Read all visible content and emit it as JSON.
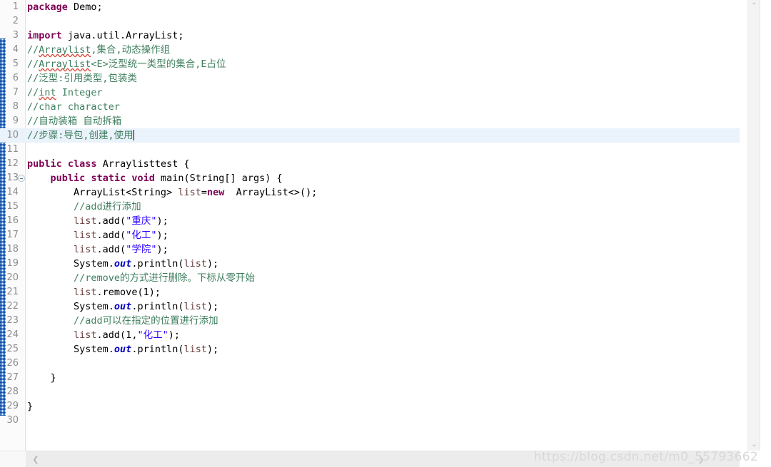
{
  "editor": {
    "gutter_first_line": 1,
    "current_line": 10,
    "total_lines": 30,
    "fold_marker_line": 13,
    "colors": {
      "keyword": "#7F0055",
      "string": "#2A00FF",
      "comment": "#3F7F5F",
      "static_field": "#0000C0",
      "local_variable": "#6A3E3E",
      "current_line_highlight": "#EAF2FB",
      "change_bar": "#1F6FC4",
      "spell_error_underline": "#D84B3C",
      "line_number": "#8D8D8D",
      "background": "#FFFFFF"
    },
    "lines": [
      {
        "n": "1",
        "tokens": [
          {
            "t": "package",
            "c": "kw"
          },
          {
            "t": " Demo;",
            "c": "plain"
          }
        ]
      },
      {
        "n": "2",
        "tokens": []
      },
      {
        "n": "3",
        "tokens": [
          {
            "t": "import",
            "c": "kw"
          },
          {
            "t": " java.util.ArrayList;",
            "c": "plain"
          }
        ]
      },
      {
        "n": "4",
        "tokens": [
          {
            "t": "//",
            "c": "cmt"
          },
          {
            "t": "Arraylist",
            "c": "cmt sq"
          },
          {
            "t": ",集合,动态操作组",
            "c": "cmt"
          }
        ]
      },
      {
        "n": "5",
        "tokens": [
          {
            "t": "//",
            "c": "cmt"
          },
          {
            "t": "Arraylist",
            "c": "cmt sq"
          },
          {
            "t": "<E>泛型统一类型的集合,E占位",
            "c": "cmt"
          }
        ]
      },
      {
        "n": "6",
        "tokens": [
          {
            "t": "//泛型:引用类型,包装类",
            "c": "cmt"
          }
        ]
      },
      {
        "n": "7",
        "tokens": [
          {
            "t": "//",
            "c": "cmt"
          },
          {
            "t": "int",
            "c": "cmt sq"
          },
          {
            "t": " Integer",
            "c": "cmt"
          }
        ]
      },
      {
        "n": "8",
        "tokens": [
          {
            "t": "//char character",
            "c": "cmt"
          }
        ]
      },
      {
        "n": "9",
        "tokens": [
          {
            "t": "//自动装箱 自动拆箱",
            "c": "cmt"
          }
        ]
      },
      {
        "n": "10",
        "tokens": [
          {
            "t": "//步骤:导包,创建,使用",
            "c": "cmt"
          }
        ],
        "caret": true,
        "current": true
      },
      {
        "n": "11",
        "tokens": []
      },
      {
        "n": "12",
        "tokens": [
          {
            "t": "public",
            "c": "kw"
          },
          {
            "t": " ",
            "c": "plain"
          },
          {
            "t": "class",
            "c": "kw"
          },
          {
            "t": " Arraylisttest {",
            "c": "plain"
          }
        ]
      },
      {
        "n": "13",
        "tokens": [
          {
            "t": "    ",
            "c": "plain"
          },
          {
            "t": "public",
            "c": "kw"
          },
          {
            "t": " ",
            "c": "plain"
          },
          {
            "t": "static",
            "c": "kw"
          },
          {
            "t": " ",
            "c": "plain"
          },
          {
            "t": "void",
            "c": "kw"
          },
          {
            "t": " main(String[] args) {",
            "c": "plain"
          }
        ],
        "fold": true
      },
      {
        "n": "14",
        "tokens": [
          {
            "t": "        ArrayList<String> ",
            "c": "plain"
          },
          {
            "t": "list",
            "c": "var"
          },
          {
            "t": "=",
            "c": "plain"
          },
          {
            "t": "new",
            "c": "kw"
          },
          {
            "t": "  ArrayList<>();",
            "c": "plain"
          }
        ]
      },
      {
        "n": "15",
        "tokens": [
          {
            "t": "        //add进行添加",
            "c": "cmt"
          }
        ]
      },
      {
        "n": "16",
        "tokens": [
          {
            "t": "        ",
            "c": "plain"
          },
          {
            "t": "list",
            "c": "var"
          },
          {
            "t": ".add(",
            "c": "plain"
          },
          {
            "t": "\"重庆\"",
            "c": "str"
          },
          {
            "t": ");",
            "c": "plain"
          }
        ]
      },
      {
        "n": "17",
        "tokens": [
          {
            "t": "        ",
            "c": "plain"
          },
          {
            "t": "list",
            "c": "var"
          },
          {
            "t": ".add(",
            "c": "plain"
          },
          {
            "t": "\"化工\"",
            "c": "str"
          },
          {
            "t": ");",
            "c": "plain"
          }
        ]
      },
      {
        "n": "18",
        "tokens": [
          {
            "t": "        ",
            "c": "plain"
          },
          {
            "t": "list",
            "c": "var"
          },
          {
            "t": ".add(",
            "c": "plain"
          },
          {
            "t": "\"学院\"",
            "c": "str"
          },
          {
            "t": ");",
            "c": "plain"
          }
        ]
      },
      {
        "n": "19",
        "tokens": [
          {
            "t": "        System.",
            "c": "plain"
          },
          {
            "t": "out",
            "c": "sfield"
          },
          {
            "t": ".println(",
            "c": "plain"
          },
          {
            "t": "list",
            "c": "var"
          },
          {
            "t": ");",
            "c": "plain"
          }
        ]
      },
      {
        "n": "20",
        "tokens": [
          {
            "t": "        //remove的方式进行删除。下标从零开始",
            "c": "cmt"
          }
        ]
      },
      {
        "n": "21",
        "tokens": [
          {
            "t": "        ",
            "c": "plain"
          },
          {
            "t": "list",
            "c": "var"
          },
          {
            "t": ".remove(1);",
            "c": "plain"
          }
        ]
      },
      {
        "n": "22",
        "tokens": [
          {
            "t": "        System.",
            "c": "plain"
          },
          {
            "t": "out",
            "c": "sfield"
          },
          {
            "t": ".println(",
            "c": "plain"
          },
          {
            "t": "list",
            "c": "var"
          },
          {
            "t": ");",
            "c": "plain"
          }
        ]
      },
      {
        "n": "23",
        "tokens": [
          {
            "t": "        //add可以在指定的位置进行添加",
            "c": "cmt"
          }
        ]
      },
      {
        "n": "24",
        "tokens": [
          {
            "t": "        ",
            "c": "plain"
          },
          {
            "t": "list",
            "c": "var"
          },
          {
            "t": ".add(1,",
            "c": "plain"
          },
          {
            "t": "\"化工\"",
            "c": "str"
          },
          {
            "t": ");",
            "c": "plain"
          }
        ]
      },
      {
        "n": "25",
        "tokens": [
          {
            "t": "        System.",
            "c": "plain"
          },
          {
            "t": "out",
            "c": "sfield"
          },
          {
            "t": ".println(",
            "c": "plain"
          },
          {
            "t": "list",
            "c": "var"
          },
          {
            "t": ");",
            "c": "plain"
          }
        ]
      },
      {
        "n": "26",
        "tokens": []
      },
      {
        "n": "27",
        "tokens": [
          {
            "t": "    }",
            "c": "plain"
          }
        ]
      },
      {
        "n": "28",
        "tokens": []
      },
      {
        "n": "29",
        "tokens": [
          {
            "t": "}",
            "c": "plain"
          }
        ]
      },
      {
        "n": "30",
        "tokens": []
      }
    ]
  },
  "scrollbars": {
    "vertical": {
      "up_arrow": "⌃",
      "down_arrow": "⌄"
    },
    "horizontal": {
      "left_arrow": "❮",
      "right_arrow": "❯"
    }
  },
  "watermark": {
    "text": "https://blog.csdn.net/m0_55793662"
  }
}
